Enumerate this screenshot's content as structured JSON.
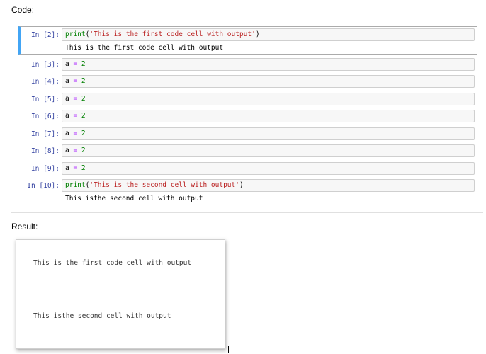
{
  "labels": {
    "code": "Code:",
    "result": "Result:"
  },
  "cells": [
    {
      "prompt": "In [2]:",
      "parts": [
        {
          "t": "print",
          "c": "kw"
        },
        {
          "t": "(",
          "c": "pl"
        },
        {
          "t": "'This is the first code cell with output'",
          "c": "str"
        },
        {
          "t": ")",
          "c": "pl"
        }
      ],
      "output": "This is the first code cell with output",
      "selected": true
    },
    {
      "prompt": "In [3]:",
      "parts": [
        {
          "t": "a ",
          "c": "pl"
        },
        {
          "t": "=",
          "c": "op"
        },
        {
          "t": " ",
          "c": "pl"
        },
        {
          "t": "2",
          "c": "num"
        }
      ]
    },
    {
      "prompt": "In [4]:",
      "parts": [
        {
          "t": "a ",
          "c": "pl"
        },
        {
          "t": "=",
          "c": "op"
        },
        {
          "t": " ",
          "c": "pl"
        },
        {
          "t": "2",
          "c": "num"
        }
      ]
    },
    {
      "prompt": "In [5]:",
      "parts": [
        {
          "t": "a ",
          "c": "pl"
        },
        {
          "t": "=",
          "c": "op"
        },
        {
          "t": " ",
          "c": "pl"
        },
        {
          "t": "2",
          "c": "num"
        }
      ]
    },
    {
      "prompt": "In [6]:",
      "parts": [
        {
          "t": "a ",
          "c": "pl"
        },
        {
          "t": "=",
          "c": "op"
        },
        {
          "t": " ",
          "c": "pl"
        },
        {
          "t": "2",
          "c": "num"
        }
      ]
    },
    {
      "prompt": "In [7]:",
      "parts": [
        {
          "t": "a ",
          "c": "pl"
        },
        {
          "t": "=",
          "c": "op"
        },
        {
          "t": " ",
          "c": "pl"
        },
        {
          "t": "2",
          "c": "num"
        }
      ]
    },
    {
      "prompt": "In [8]:",
      "parts": [
        {
          "t": "a ",
          "c": "pl"
        },
        {
          "t": "=",
          "c": "op"
        },
        {
          "t": " ",
          "c": "pl"
        },
        {
          "t": "2",
          "c": "num"
        }
      ]
    },
    {
      "prompt": "In [9]:",
      "parts": [
        {
          "t": "a ",
          "c": "pl"
        },
        {
          "t": "=",
          "c": "op"
        },
        {
          "t": " ",
          "c": "pl"
        },
        {
          "t": "2",
          "c": "num"
        }
      ]
    },
    {
      "prompt": "In [10]:",
      "parts": [
        {
          "t": "print",
          "c": "kw"
        },
        {
          "t": "(",
          "c": "pl"
        },
        {
          "t": "'This is the second cell with output'",
          "c": "str"
        },
        {
          "t": ")",
          "c": "pl"
        }
      ],
      "output": "This isthe second cell with output"
    }
  ],
  "result": {
    "line1": "This is the first code cell with output",
    "line2": "This isthe second cell with output"
  },
  "colors": {
    "selected_bar": "#42a5f5",
    "prompt": "#303f9f",
    "keyword": "#008000",
    "string": "#ba2121",
    "operator": "#aa22ff"
  }
}
